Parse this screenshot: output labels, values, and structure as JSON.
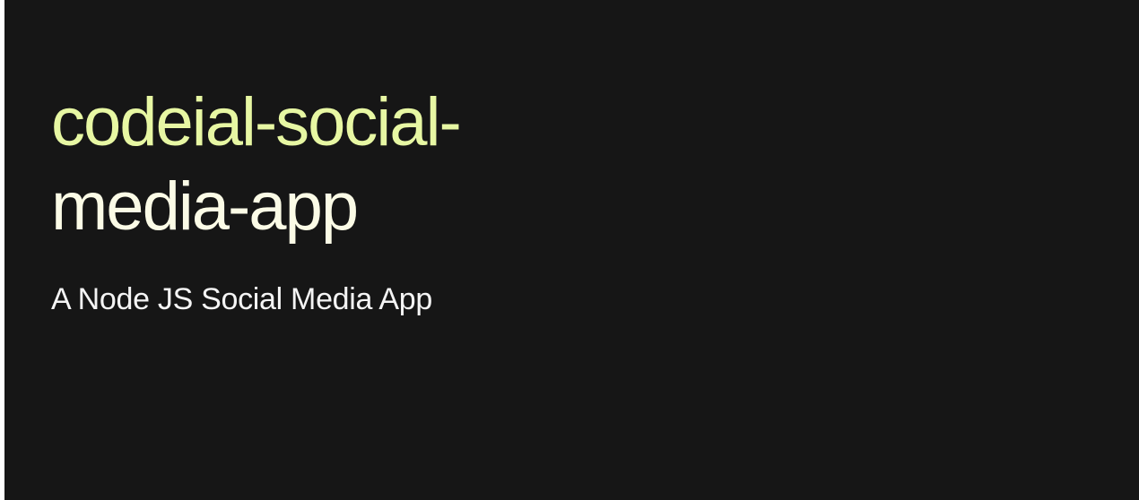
{
  "card": {
    "title_line1": "codeial-social-",
    "title_line2": "media-app",
    "subtitle": "A Node JS Social Media App"
  },
  "colors": {
    "background": "#161616",
    "title_line1": "#e7f7a3",
    "title_line2": "#fbfbe6",
    "subtitle": "#f4f4f4"
  }
}
